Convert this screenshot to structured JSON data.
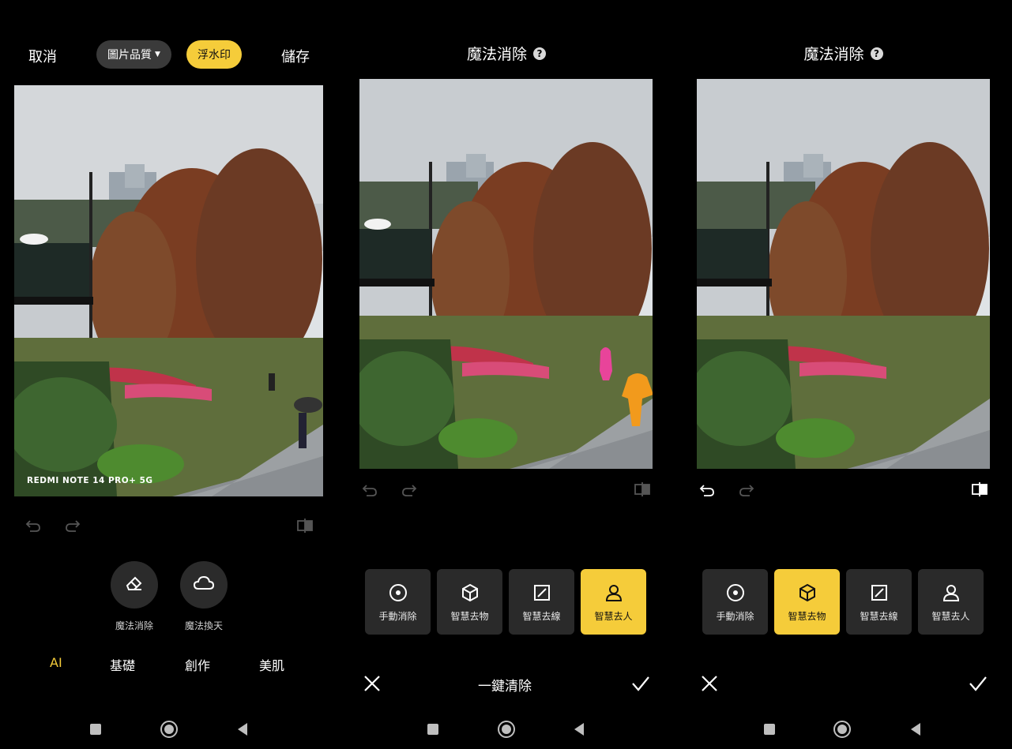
{
  "panel1": {
    "cancel_label": "取消",
    "quality_label": "圖片品質",
    "watermark_label": "浮水印",
    "save_label": "儲存",
    "watermark_text": "REDMI NOTE 14 PRO+ 5G",
    "tools": [
      {
        "label": "魔法消除",
        "icon": "eraser-icon"
      },
      {
        "label": "魔法換天",
        "icon": "cloud-icon"
      }
    ],
    "tabs": [
      {
        "label": "AI",
        "active": true
      },
      {
        "label": "基礎",
        "active": false
      },
      {
        "label": "創作",
        "active": false
      },
      {
        "label": "美肌",
        "active": false
      }
    ]
  },
  "panel2": {
    "title": "魔法消除",
    "help_glyph": "?",
    "tools": [
      {
        "label": "手動消除",
        "icon": "target-circle-icon",
        "active": false
      },
      {
        "label": "智慧去物",
        "icon": "cube-icon",
        "active": false
      },
      {
        "label": "智慧去線",
        "icon": "line-box-icon",
        "active": false
      },
      {
        "label": "智慧去人",
        "icon": "person-icon",
        "active": true
      }
    ],
    "one_click_label": "一鍵清除"
  },
  "panel3": {
    "title": "魔法消除",
    "help_glyph": "?",
    "tools": [
      {
        "label": "手動消除",
        "icon": "target-circle-icon",
        "active": false
      },
      {
        "label": "智慧去物",
        "icon": "cube-icon",
        "active": true
      },
      {
        "label": "智慧去線",
        "icon": "line-box-icon",
        "active": false
      },
      {
        "label": "智慧去人",
        "icon": "person-icon",
        "active": false
      }
    ]
  },
  "colors": {
    "accent": "#f5cc3a",
    "background": "#000000",
    "tool_bg": "#2a2a2a",
    "mask_pink": "#e8449a",
    "mask_orange": "#f29a1c"
  }
}
